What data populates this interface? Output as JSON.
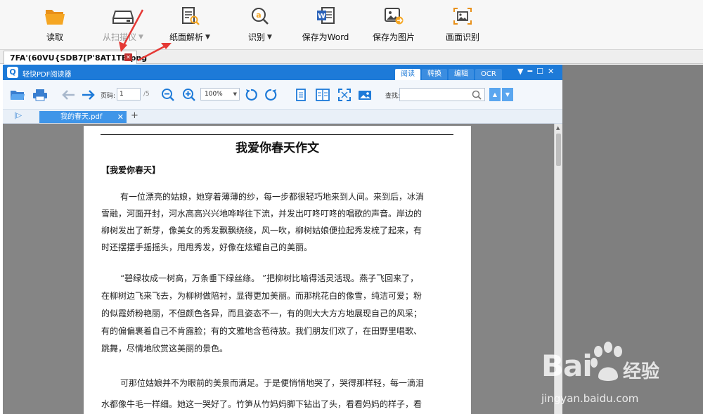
{
  "toolbar": {
    "read_label": "读取",
    "scanner_label": "从扫描仪",
    "paper_analysis_label": "纸面解析",
    "recognize_label": "识别",
    "save_word_label": "保存为Word",
    "save_image_label": "保存为图片",
    "screen_recognize_label": "画面识别"
  },
  "doc_tab": {
    "name": "7FA'(60VU{SDB7[P'8AT1TB.png"
  },
  "reader": {
    "app_name": "轻快PDF阅读器",
    "mode_tabs": [
      "阅读",
      "转换",
      "编辑",
      "OCR"
    ],
    "page_label": "页码:",
    "page_value": "1",
    "page_total": "/5",
    "zoom_value": "100%",
    "find_label": "查找:",
    "doc_tab_name": "我的春天.pdf"
  },
  "document": {
    "title": "我爱你春天作文",
    "subtitle": "【我爱你春天】",
    "lines": [
      "有一位漂亮的姑娘，她穿着薄薄的纱，每一步都很轻巧地来到人间。来到后，冰消",
      "雪融，河面开封，河水高高兴兴地哗哗往下流，并发出叮咚叮咚的唱歌的声音。岸边的",
      "柳树发出了新芽，像美女的秀发飘飘绕绕，风一吹，柳树姑娘便拉起秀发梳了起来，有",
      "时还摆摆手摇摇头，甩甩秀发，好像在炫耀自己的美丽。",
      "“碧绿妆成一树高，万条垂下绿丝绦。 ”把柳树比喻得活灵活现。燕子飞回来了，",
      "在柳树边飞来飞去，为柳树做陪衬，显得更加美丽。而那桃花白的像雪，纯洁可爱；粉",
      "的似霞娇粉艳丽，不但颜色各异，而且姿态不一，有的则大大方方地展现自己的风采；",
      "有的偏偏裹着自己不肯露脸；有的文雅地含苞待放。我们朋友们欢了，在田野里唱歌、",
      "跳舞，尽情地欣赏这美丽的景色。",
      "可那位姑娘并不为眼前的美景而满足。于是便悄悄地哭了，哭得那样轻，每一滴泪",
      "水都像牛毛一样细。她这一哭好了。竹笋从竹妈妈脚下钻出了头，看看妈妈的样子，看"
    ]
  },
  "watermark": {
    "brand": "Bai",
    "brand2": "经验",
    "url": "jingyan.baidu.com"
  },
  "colors": {
    "accent": "#1d7ad8",
    "arrow": "#e53935"
  }
}
